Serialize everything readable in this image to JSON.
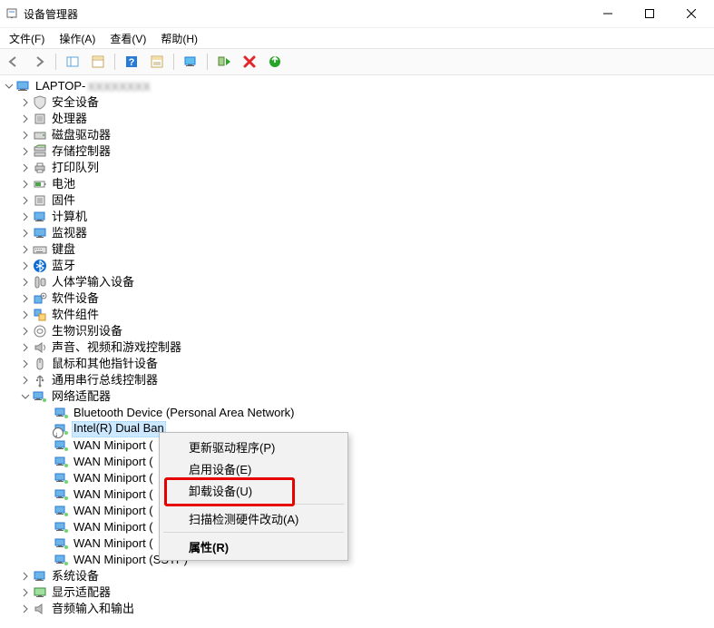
{
  "window": {
    "title": "设备管理器"
  },
  "menus": {
    "file": "文件(F)",
    "action": "操作(A)",
    "view": "查看(V)",
    "help": "帮助(H)"
  },
  "tree": {
    "root": "LAPTOP-",
    "categories": [
      {
        "label": "安全设备",
        "iconType": "shield"
      },
      {
        "label": "处理器",
        "iconType": "cpu"
      },
      {
        "label": "磁盘驱动器",
        "iconType": "disk"
      },
      {
        "label": "存储控制器",
        "iconType": "storage"
      },
      {
        "label": "打印队列",
        "iconType": "printer"
      },
      {
        "label": "电池",
        "iconType": "battery"
      },
      {
        "label": "固件",
        "iconType": "firmware"
      },
      {
        "label": "计算机",
        "iconType": "computer"
      },
      {
        "label": "监视器",
        "iconType": "monitor"
      },
      {
        "label": "键盘",
        "iconType": "keyboard"
      },
      {
        "label": "蓝牙",
        "iconType": "bluetooth"
      },
      {
        "label": "人体学输入设备",
        "iconType": "hid"
      },
      {
        "label": "软件设备",
        "iconType": "software"
      },
      {
        "label": "软件组件",
        "iconType": "swcomp"
      },
      {
        "label": "生物识别设备",
        "iconType": "bio"
      },
      {
        "label": "声音、视频和游戏控制器",
        "iconType": "audio"
      },
      {
        "label": "鼠标和其他指针设备",
        "iconType": "mouse"
      },
      {
        "label": "通用串行总线控制器",
        "iconType": "usb"
      }
    ],
    "network": {
      "label": "网络适配器",
      "children": [
        {
          "label": "Bluetooth Device (Personal Area Network)",
          "disabled": false
        },
        {
          "label": "Intel(R) Dual Ban",
          "disabled": true,
          "selected": true
        },
        {
          "label": "WAN Miniport (",
          "disabled": false
        },
        {
          "label": "WAN Miniport (",
          "disabled": false
        },
        {
          "label": "WAN Miniport (",
          "disabled": false
        },
        {
          "label": "WAN Miniport (",
          "disabled": false
        },
        {
          "label": "WAN Miniport (",
          "disabled": false
        },
        {
          "label": "WAN Miniport (",
          "disabled": false
        },
        {
          "label": "WAN Miniport (",
          "disabled": false
        },
        {
          "label": "WAN Miniport (SSTP)",
          "disabled": false
        }
      ]
    },
    "after": [
      {
        "label": "系统设备",
        "iconType": "computer"
      },
      {
        "label": "显示适配器",
        "iconType": "display"
      },
      {
        "label": "音频输入和输出",
        "iconType": "audio2"
      }
    ]
  },
  "contextMenu": {
    "items": {
      "update": "更新驱动程序(P)",
      "enable": "启用设备(E)",
      "uninstall": "卸载设备(U)",
      "rescan": "扫描检测硬件改动(A)",
      "properties": "属性(R)"
    }
  },
  "icons": {
    "arrowBackColor": "#808080",
    "arrowFwdColor": "#808080",
    "helpBg": "#2a7bd6",
    "refreshGreen": "#28a428",
    "deleteRed": "#e3262a",
    "monitorBlue": "#2f8fd9",
    "bluetoothBlue": "#0a6dd6"
  }
}
